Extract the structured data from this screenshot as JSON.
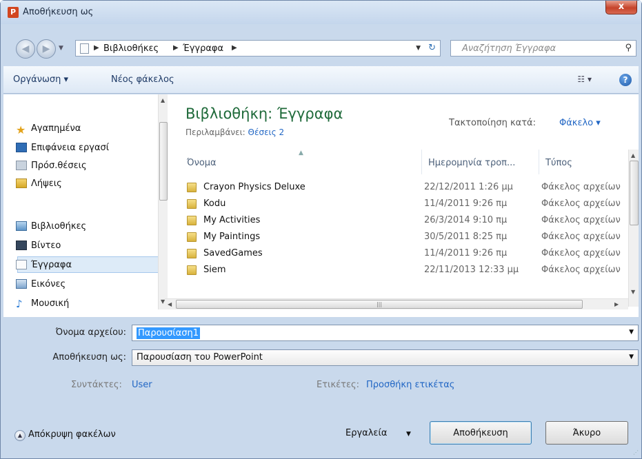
{
  "window": {
    "title": "Αποθήκευση ως",
    "app_icon": "P",
    "close_label": "x"
  },
  "address_bar": {
    "breadcrumbs": [
      "Βιβλιοθήκες",
      "Έγγραφα"
    ],
    "search_placeholder": "Αναζήτηση Έγγραφα"
  },
  "toolbar": {
    "organize_label": "Οργάνωση ▾",
    "new_folder_label": "Νέος φάκελος",
    "help_label": "?"
  },
  "sidebar": {
    "favorites": "Αγαπημένα",
    "favorites_items": [
      "Επιφάνεια εργασί",
      "Πρόσ.θέσεις",
      "Λήψεις"
    ],
    "libraries": "Βιβλιοθήκες",
    "library_items": [
      "Βίντεο",
      "Έγγραφα",
      "Εικόνες",
      "Μουσική"
    ],
    "selected": "Έγγραφα"
  },
  "content": {
    "library_title": "Βιβλιοθήκη: Έγγραφα",
    "includes_label": "Περιλαμβάνει:",
    "includes_link": "Θέσεις 2",
    "arrange_label": "Τακτοποίηση κατά:",
    "arrange_value": "Φάκελο ▾",
    "columns": {
      "name": "Όνομα",
      "date": "Ημερομηνία τροπ...",
      "type": "Τύπος"
    },
    "files": [
      {
        "name": "Crayon Physics Deluxe",
        "date": "22/12/2011 1:26 μμ",
        "type": "Φάκελος αρχείων"
      },
      {
        "name": "Kodu",
        "date": "11/4/2011 9:26 πμ",
        "type": "Φάκελος αρχείων"
      },
      {
        "name": "My Activities",
        "date": "26/3/2014 9:10 πμ",
        "type": "Φάκελος αρχείων"
      },
      {
        "name": "My Paintings",
        "date": "30/5/2011 8:25 πμ",
        "type": "Φάκελος αρχείων"
      },
      {
        "name": "SavedGames",
        "date": "11/4/2011 9:26 πμ",
        "type": "Φάκελος αρχείων"
      },
      {
        "name": "Siem",
        "date": "22/11/2013 12:33 μμ",
        "type": "Φάκελος αρχείων"
      }
    ]
  },
  "form": {
    "filename_label": "Όνομα αρχείου:",
    "filename_value": "Παρουσίαση1",
    "savetype_label": "Αποθήκευση ως:",
    "savetype_value": "Παρουσίαση του PowerPoint",
    "authors_label": "Συντάκτες:",
    "authors_value": "User",
    "tags_label": "Ετικέτες:",
    "tags_value": "Προσθήκη ετικέτας"
  },
  "footer": {
    "hide_folders": "Απόκρυψη φακέλων",
    "tools": "Εργαλεία",
    "save": "Αποθήκευση",
    "cancel": "Άκυρο"
  }
}
